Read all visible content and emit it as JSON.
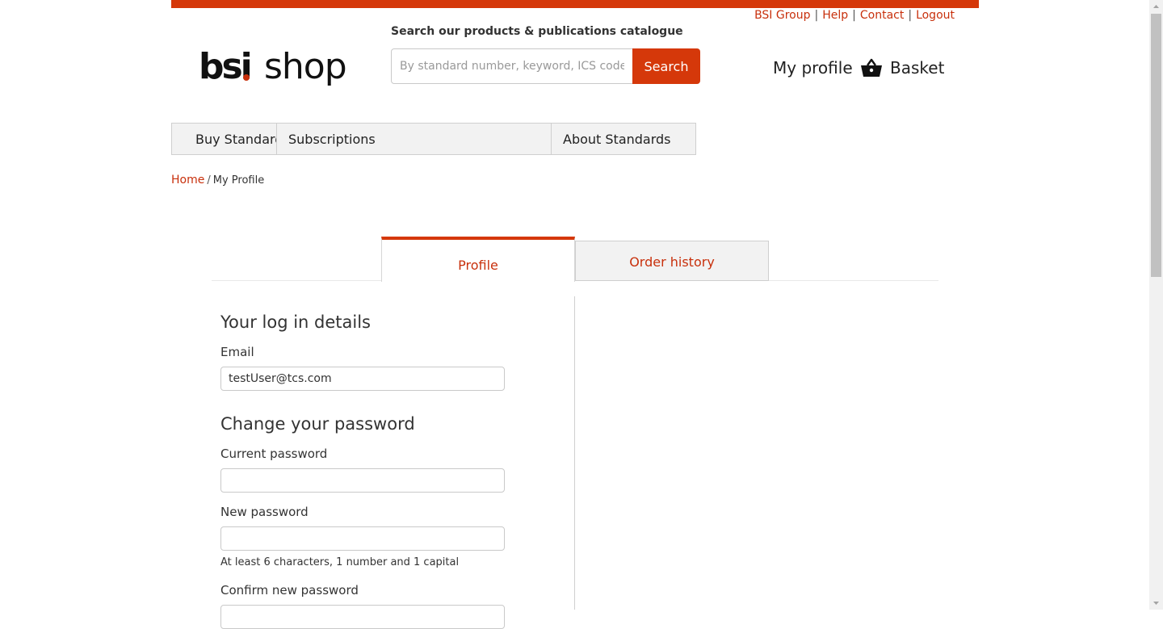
{
  "header": {
    "util_links": [
      "BSI Group",
      "Help",
      "Contact",
      "Logout"
    ],
    "logo_bsi": "bsi",
    "logo_shop": "shop",
    "search_heading": "Search our products & publications catalogue",
    "search_placeholder": "By standard number, keyword, ICS code, ISBN",
    "search_button": "Search",
    "my_profile": "My profile",
    "basket": "Basket",
    "basket_icon": "basket-icon"
  },
  "nav": {
    "items": [
      "Buy Standards",
      "Subscriptions",
      "About Standards"
    ]
  },
  "breadcrumb": {
    "home": "Home",
    "separator": "/",
    "current": "My Profile"
  },
  "tabs": [
    "Profile",
    "Order history"
  ],
  "form": {
    "login_heading": "Your log in details",
    "email_label": "Email",
    "email_value": "testUser@tcs.com",
    "password_heading": "Change your password",
    "current_password_label": "Current password",
    "new_password_label": "New password",
    "password_hint": "At least 6 characters, 1 number and 1 capital",
    "confirm_password_label": "Confirm new password"
  },
  "colors": {
    "brand": "#d5380a",
    "link": "#c8300c"
  }
}
